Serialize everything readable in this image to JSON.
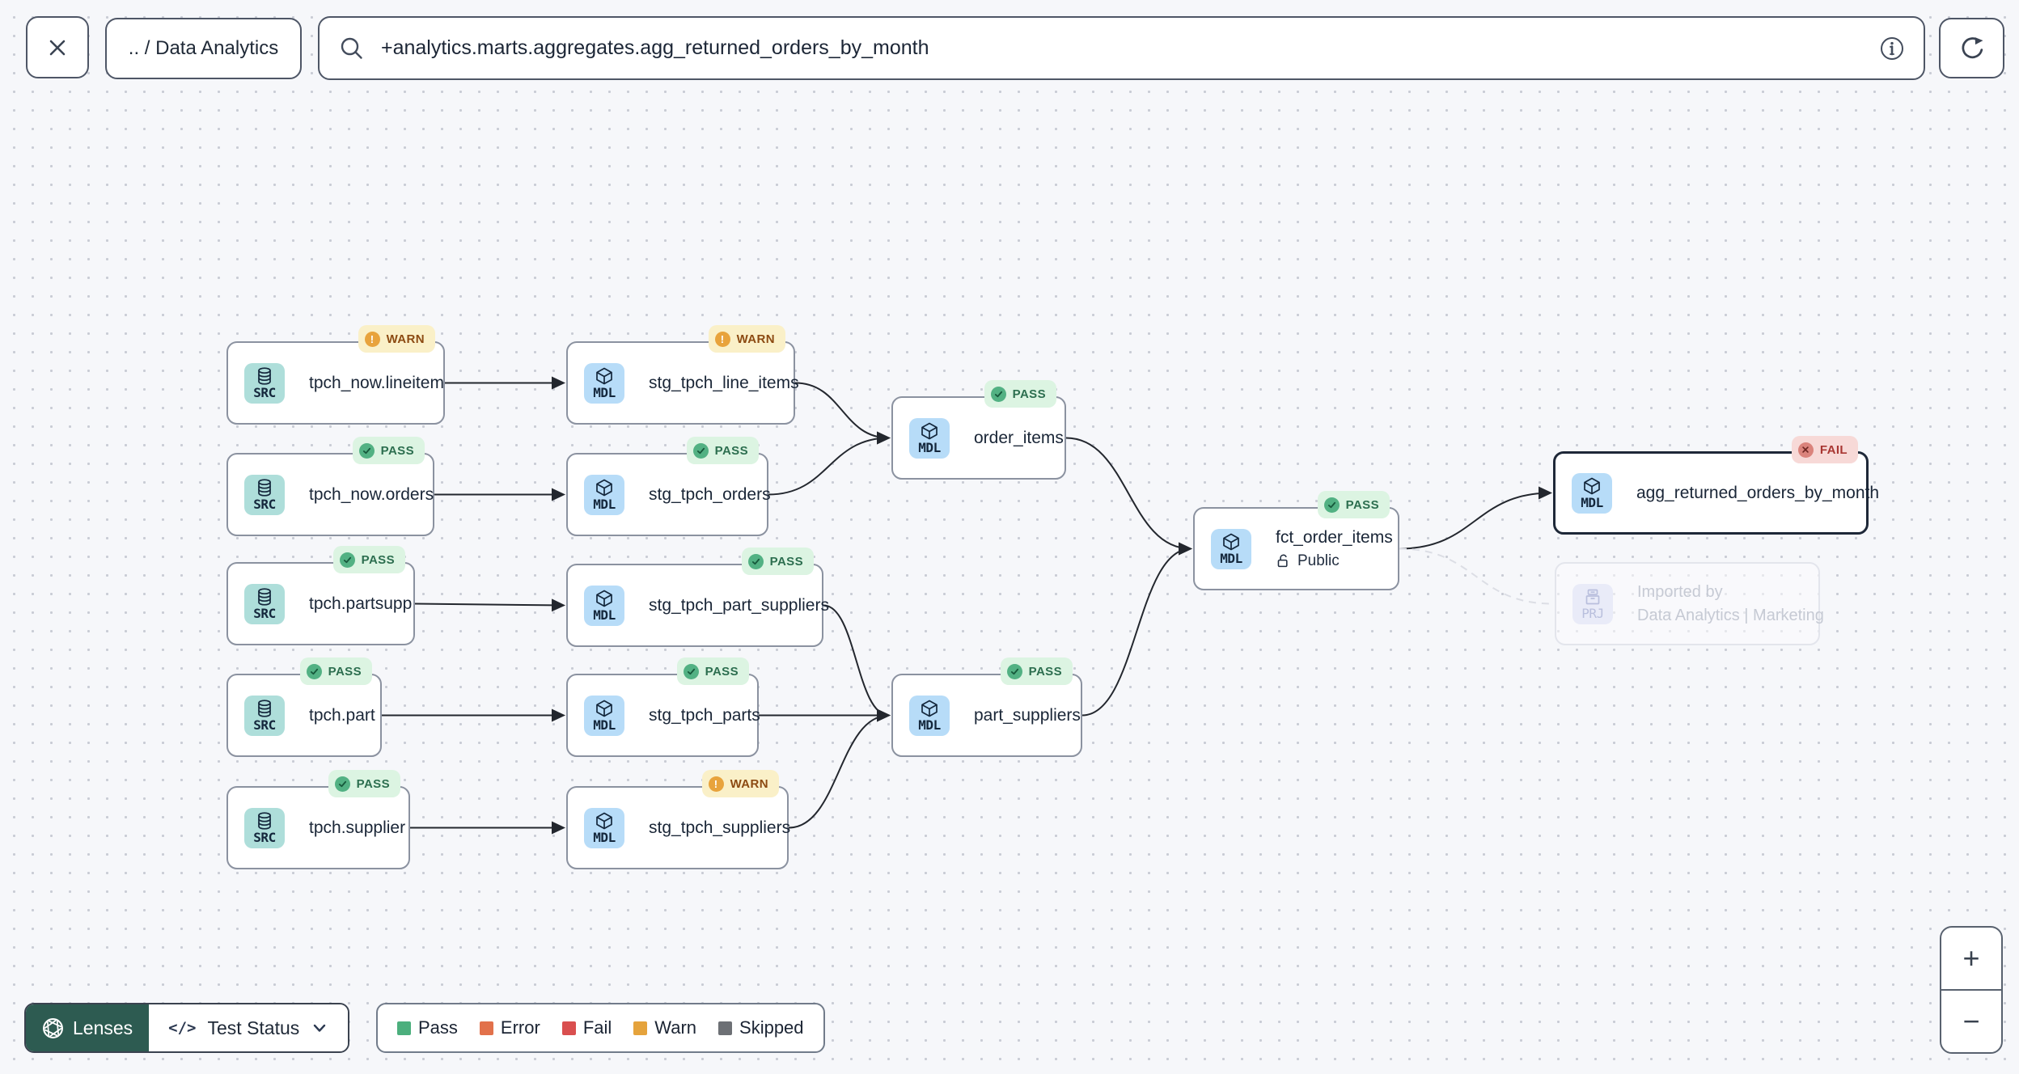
{
  "topbar": {
    "breadcrumb": ".. / Data Analytics",
    "search": {
      "value": "+analytics.marts.aggregates.agg_returned_orders_by_month"
    }
  },
  "icons": {
    "close": "close-icon",
    "search": "search-icon",
    "info": "info-icon",
    "refresh": "refresh-icon",
    "lenses": "aperture-icon",
    "code": "</>",
    "chevron_down": "chevron-down-icon",
    "lock_open": "open-padlock-icon"
  },
  "graph": {
    "nodes": [
      {
        "id": "tpch_now.lineitem",
        "label": "tpch_now.lineitem",
        "kind": "SRC",
        "badge": "WARN"
      },
      {
        "id": "tpch_now.orders",
        "label": "tpch_now.orders",
        "kind": "SRC",
        "badge": "PASS"
      },
      {
        "id": "tpch.partsupp",
        "label": "tpch.partsupp",
        "kind": "SRC",
        "badge": "PASS"
      },
      {
        "id": "tpch.part",
        "label": "tpch.part",
        "kind": "SRC",
        "badge": "PASS"
      },
      {
        "id": "tpch.supplier",
        "label": "tpch.supplier",
        "kind": "SRC",
        "badge": "PASS"
      },
      {
        "id": "stg_tpch_line_items",
        "label": "stg_tpch_line_items",
        "kind": "MDL",
        "badge": "WARN"
      },
      {
        "id": "stg_tpch_orders",
        "label": "stg_tpch_orders",
        "kind": "MDL",
        "badge": "PASS"
      },
      {
        "id": "stg_tpch_part_suppliers",
        "label": "stg_tpch_part_suppliers",
        "kind": "MDL",
        "badge": "PASS"
      },
      {
        "id": "stg_tpch_parts",
        "label": "stg_tpch_parts",
        "kind": "MDL",
        "badge": "PASS"
      },
      {
        "id": "stg_tpch_suppliers",
        "label": "stg_tpch_suppliers",
        "kind": "MDL",
        "badge": "WARN"
      },
      {
        "id": "order_items",
        "label": "order_items",
        "kind": "MDL",
        "badge": "PASS"
      },
      {
        "id": "part_suppliers",
        "label": "part_suppliers",
        "kind": "MDL",
        "badge": "PASS"
      },
      {
        "id": "fct_order_items",
        "label": "fct_order_items",
        "kind": "MDL",
        "badge": "PASS",
        "sublabel": "Public"
      },
      {
        "id": "agg_returned_orders_by_month",
        "label": "agg_returned_orders_by_month",
        "kind": "MDL",
        "badge": "FAIL",
        "selected": true
      },
      {
        "id": "imported_by",
        "kind": "PRJ",
        "ghost": true,
        "lines": [
          "Imported by",
          "Data Analytics | Marketing"
        ]
      }
    ],
    "edges": [
      {
        "from": "tpch_now.lineitem",
        "to": "stg_tpch_line_items"
      },
      {
        "from": "tpch_now.orders",
        "to": "stg_tpch_orders"
      },
      {
        "from": "tpch.partsupp",
        "to": "stg_tpch_part_suppliers"
      },
      {
        "from": "tpch.part",
        "to": "stg_tpch_parts"
      },
      {
        "from": "tpch.supplier",
        "to": "stg_tpch_suppliers"
      },
      {
        "from": "stg_tpch_line_items",
        "to": "order_items"
      },
      {
        "from": "stg_tpch_orders",
        "to": "order_items"
      },
      {
        "from": "stg_tpch_part_suppliers",
        "to": "part_suppliers"
      },
      {
        "from": "stg_tpch_parts",
        "to": "part_suppliers"
      },
      {
        "from": "stg_tpch_suppliers",
        "to": "part_suppliers"
      },
      {
        "from": "order_items",
        "to": "fct_order_items"
      },
      {
        "from": "part_suppliers",
        "to": "fct_order_items"
      },
      {
        "from": "fct_order_items",
        "to": "agg_returned_orders_by_month"
      },
      {
        "from": "fct_order_items",
        "to": "imported_by",
        "dashed": true
      }
    ]
  },
  "toolbar": {
    "lenses_label": "Lenses",
    "lens_selected": "Test Status"
  },
  "legend": {
    "items": [
      {
        "label": "Pass",
        "color": "#4caf7d"
      },
      {
        "label": "Error",
        "color": "#e2714b"
      },
      {
        "label": "Fail",
        "color": "#d94f4f"
      },
      {
        "label": "Warn",
        "color": "#e5a33c"
      },
      {
        "label": "Skipped",
        "color": "#6d7075"
      }
    ]
  },
  "zoom": {
    "in": "+",
    "out": "−"
  },
  "colors": {
    "badge_pass_bg": "#dcf4e2",
    "badge_pass_text": "#2c6e4f",
    "badge_pass_dot": "#52b183",
    "badge_warn_bg": "#faf0c8",
    "badge_warn_text": "#8c4a12",
    "badge_warn_dot": "#e8a33c",
    "badge_fail_bg": "#f7d9d7",
    "badge_fail_text": "#a83632",
    "badge_fail_dot": "#da837c",
    "tile_src": "#aededa",
    "tile_mdl": "#b7dcf8",
    "tile_prj": "#e9ebf8",
    "lenses_bg": "#2d5b51",
    "edge": "#23272e",
    "canvas": "#f6f7fa"
  }
}
